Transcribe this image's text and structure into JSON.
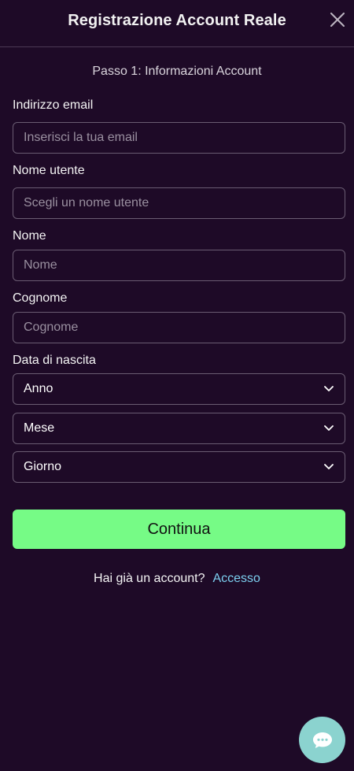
{
  "header": {
    "title": "Registrazione Account Reale"
  },
  "step": {
    "title": "Passo 1: Informazioni Account"
  },
  "form": {
    "email": {
      "label": "Indirizzo email",
      "placeholder": "Inserisci la tua email",
      "value": ""
    },
    "username": {
      "label": "Nome utente",
      "placeholder": "Scegli un nome utente",
      "value": ""
    },
    "first_name": {
      "label": "Nome",
      "placeholder": "Nome",
      "value": ""
    },
    "last_name": {
      "label": "Cognome",
      "placeholder": "Cognome",
      "value": ""
    },
    "birth_date": {
      "label": "Data di nascita",
      "year": "Anno",
      "month": "Mese",
      "day": "Giorno"
    }
  },
  "actions": {
    "continue_label": "Continua"
  },
  "footer": {
    "question": "Hai già un account?",
    "login_label": "Accesso"
  },
  "icons": {
    "close": "close-icon",
    "dropdown": "chevron-down-icon",
    "chat": "chat-icon"
  },
  "colors": {
    "background": "#1e0a27",
    "accent": "#76fb86",
    "link": "#7cd0f0",
    "chat": "#8bd3cf"
  }
}
